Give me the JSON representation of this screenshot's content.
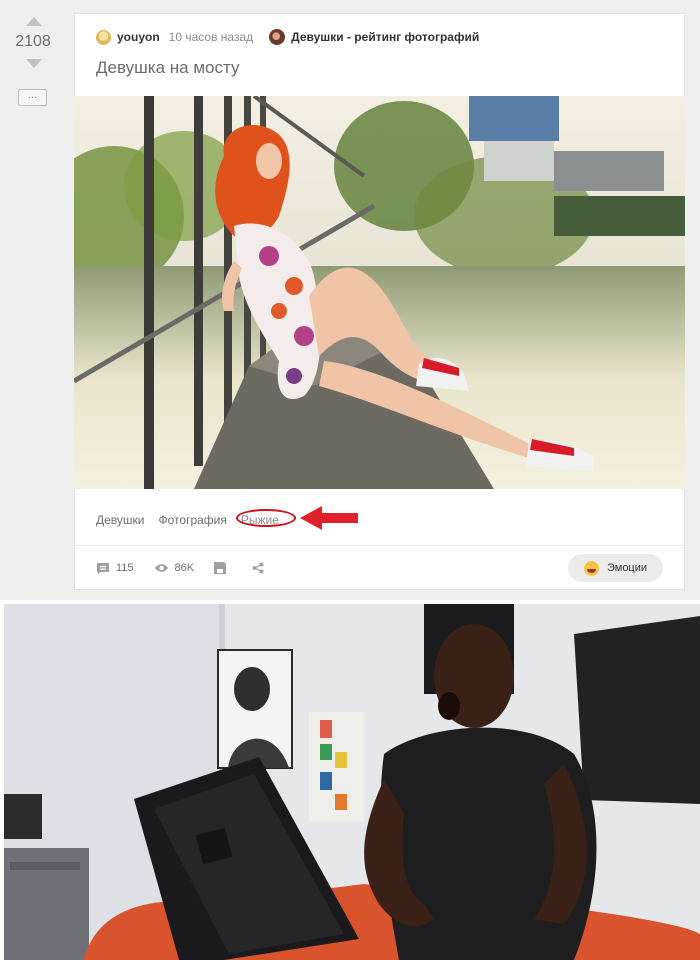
{
  "post": {
    "rating": "2108",
    "more_label": "···",
    "author": "youyon",
    "time": "10 часов назад",
    "community": "Девушки - рейтинг фотографий",
    "title": "Девушка на мосту",
    "tags": [
      "Девушки",
      "Фотография",
      "Рыжие"
    ],
    "comments_count": "115",
    "views_count": "86K",
    "emotions_label": "Эмоции"
  },
  "colors": {
    "background": "#efefef",
    "card": "#ffffff",
    "highlight_red": "#d0101a",
    "text_gray": "#6d6d6d"
  },
  "icons": {
    "vote_up": "arrow-up-icon",
    "vote_down": "arrow-down-icon",
    "comments": "comment-icon",
    "views": "eye-icon",
    "save": "save-icon",
    "share": "share-icon",
    "emotion": "smiley-icon"
  }
}
